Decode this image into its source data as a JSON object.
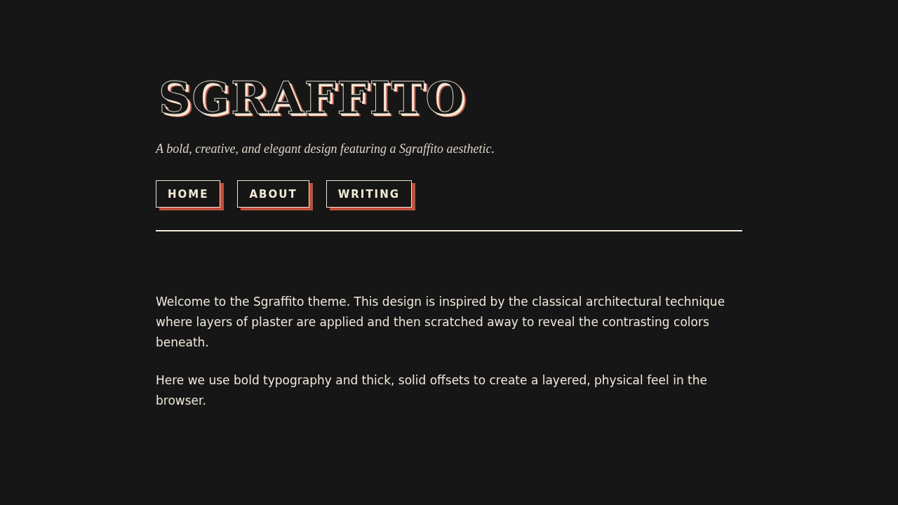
{
  "site": {
    "title": "SGRAFFITO",
    "tagline": "A bold, creative, and elegant design featuring a Sgraffito aesthetic."
  },
  "nav": [
    "HOME",
    "ABOUT",
    "WRITING"
  ],
  "content": {
    "paragraphs": [
      "Welcome to the Sgraffito theme. This design is inspired by the classical architectural technique where layers of plaster are applied and then scratched away to reveal the contrasting colors beneath.",
      "Here we use bold typography and thick, solid offsets to create a layered, physical feel in the browser."
    ]
  }
}
